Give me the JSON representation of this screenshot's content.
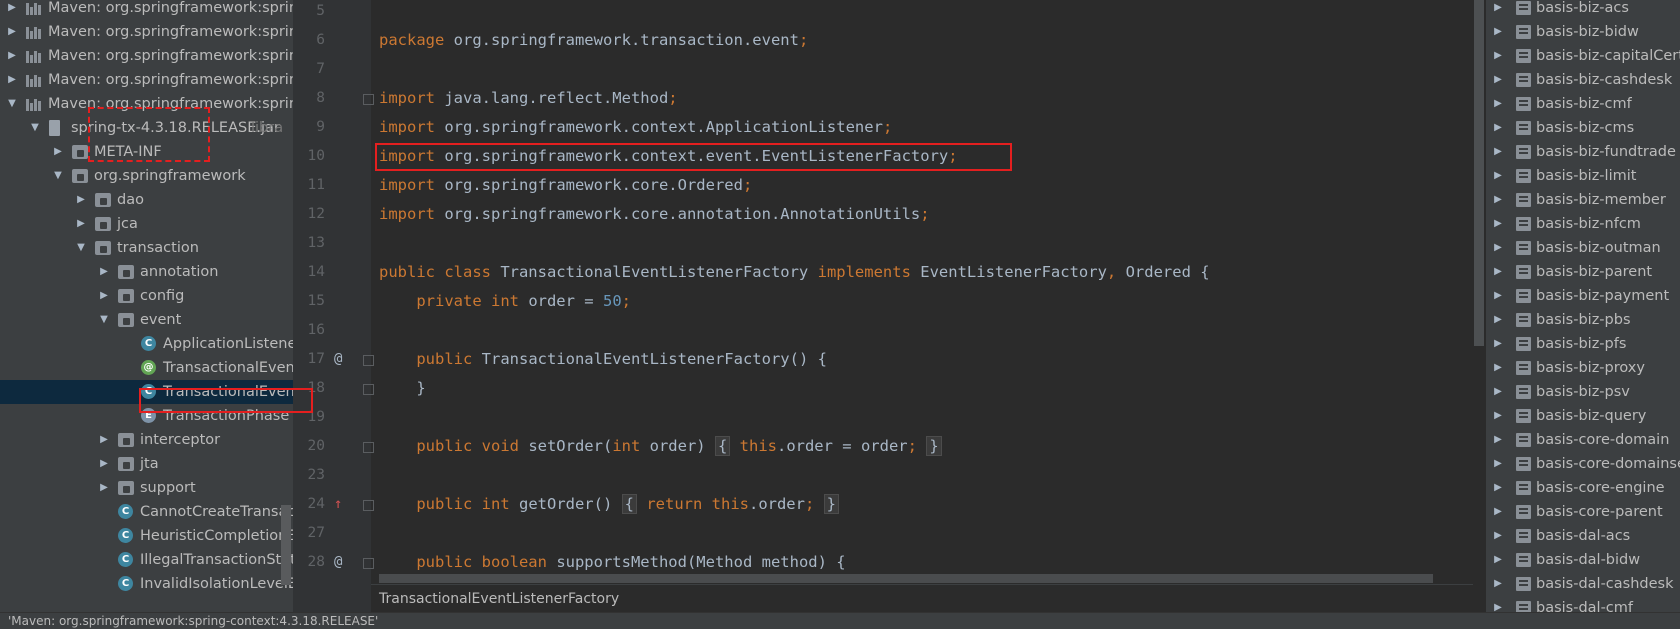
{
  "tree": [
    {
      "indent": 0,
      "arrow": "▶",
      "icon": "maven",
      "label": "Maven: org.springframework:spring-",
      "sel": false
    },
    {
      "indent": 0,
      "arrow": "▶",
      "icon": "maven",
      "label": "Maven: org.springframework:spring-",
      "sel": false
    },
    {
      "indent": 0,
      "arrow": "▶",
      "icon": "maven",
      "label": "Maven: org.springframework:spring-",
      "sel": false
    },
    {
      "indent": 0,
      "arrow": "▶",
      "icon": "maven",
      "label": "Maven: org.springframework:spring-",
      "sel": false
    },
    {
      "indent": 0,
      "arrow": "▼",
      "icon": "maven",
      "label": "Maven: org.springframework:spring-",
      "sel": false
    },
    {
      "indent": 1,
      "arrow": "▼",
      "icon": "jar",
      "label": "spring-tx-4.3.18.RELEASE.jar",
      "suffix": "libra",
      "sel": false
    },
    {
      "indent": 2,
      "arrow": "▶",
      "icon": "folder",
      "label": "META-INF",
      "sel": false
    },
    {
      "indent": 2,
      "arrow": "▼",
      "icon": "folder",
      "label": "org.springframework",
      "sel": false
    },
    {
      "indent": 3,
      "arrow": "▶",
      "icon": "folder",
      "label": "dao",
      "sel": false
    },
    {
      "indent": 3,
      "arrow": "▶",
      "icon": "folder",
      "label": "jca",
      "sel": false
    },
    {
      "indent": 3,
      "arrow": "▼",
      "icon": "folder",
      "label": "transaction",
      "sel": false
    },
    {
      "indent": 4,
      "arrow": "▶",
      "icon": "folder",
      "label": "annotation",
      "sel": false
    },
    {
      "indent": 4,
      "arrow": "▶",
      "icon": "folder",
      "label": "config",
      "sel": false
    },
    {
      "indent": 4,
      "arrow": "▼",
      "icon": "folder",
      "label": "event",
      "sel": false
    },
    {
      "indent": 5,
      "arrow": "",
      "icon": "class",
      "label": "ApplicationListene",
      "sel": false
    },
    {
      "indent": 5,
      "arrow": "",
      "icon": "anno",
      "label": "TransactionalEvent",
      "sel": false
    },
    {
      "indent": 5,
      "arrow": "",
      "icon": "class",
      "label": "TransactionalEvent",
      "sel": true
    },
    {
      "indent": 5,
      "arrow": "",
      "icon": "enum",
      "label": "TransactionPhase",
      "sel": false
    },
    {
      "indent": 4,
      "arrow": "▶",
      "icon": "folder",
      "label": "interceptor",
      "sel": false
    },
    {
      "indent": 4,
      "arrow": "▶",
      "icon": "folder",
      "label": "jta",
      "sel": false
    },
    {
      "indent": 4,
      "arrow": "▶",
      "icon": "folder",
      "label": "support",
      "sel": false
    },
    {
      "indent": 4,
      "arrow": "",
      "icon": "class",
      "label": "CannotCreateTransact",
      "sel": false
    },
    {
      "indent": 4,
      "arrow": "",
      "icon": "class",
      "label": "HeuristicCompletionEx",
      "sel": false
    },
    {
      "indent": 4,
      "arrow": "",
      "icon": "class",
      "label": "IllegalTransactionState",
      "sel": false
    },
    {
      "indent": 4,
      "arrow": "",
      "icon": "class",
      "label": "InvalidIsolationLevelEx",
      "sel": false
    }
  ],
  "code": [
    {
      "num": "5",
      "html": ""
    },
    {
      "num": "6",
      "html": "<span class='kw'>package</span> org.springframework.transaction.event<span class='sm'>;</span>"
    },
    {
      "num": "7",
      "html": ""
    },
    {
      "num": "8",
      "html": "<span class='kw'>import</span> java.lang.reflect.Method<span class='sm'>;</span>"
    },
    {
      "num": "9",
      "html": "<span class='kw'>import</span> org.springframework.context.ApplicationListener<span class='sm'>;</span>"
    },
    {
      "num": "10",
      "html": "<span class='kw'>import</span> org.springframework.context.event.EventListenerFactory<span class='sm'>;</span>"
    },
    {
      "num": "11",
      "html": "<span class='kw'>import</span> org.springframework.core.Ordered<span class='sm'>;</span>"
    },
    {
      "num": "12",
      "html": "<span class='kw'>import</span> org.springframework.core.annotation.AnnotationUtils<span class='sm'>;</span>"
    },
    {
      "num": "13",
      "html": ""
    },
    {
      "num": "14",
      "html": "<span class='kw'>public class</span> TransactionalEventListenerFactory <span class='kw'>implements</span> EventListenerFactory<span class='sm'>,</span> Ordered {"
    },
    {
      "num": "15",
      "html": "    <span class='kw'>private int</span> order = <span class='num'>50</span><span class='sm'>;</span>"
    },
    {
      "num": "16",
      "html": ""
    },
    {
      "num": "17",
      "html": "    <span class='kw'>public</span> TransactionalEventListenerFactory() {"
    },
    {
      "num": "18",
      "html": "    }"
    },
    {
      "num": "19",
      "html": ""
    },
    {
      "num": "20",
      "html": "    <span class='kw'>public void</span> setOrder(<span class='kw'>int</span> order) <span class='brk'>{</span> <span class='kw'>this</span>.order = order<span class='sm'>;</span> <span class='brk'>}</span>"
    },
    {
      "num": "23",
      "html": ""
    },
    {
      "num": "24",
      "html": "    <span class='kw'>public int</span> getOrder() <span class='brk'>{</span> <span class='kw'>return this</span>.order<span class='sm'>;</span> <span class='brk'>}</span>"
    },
    {
      "num": "27",
      "html": ""
    },
    {
      "num": "28",
      "html": "    <span class='kw'>public boolean</span> supportsMethod(Method method) {"
    }
  ],
  "gutter_marks": {
    "17": "@",
    "24": "!",
    "28": "@"
  },
  "breadcrumb": "TransactionalEventListenerFactory",
  "modules": [
    "basis-biz-acs",
    "basis-biz-bidw",
    "basis-biz-capitalCert",
    "basis-biz-cashdesk",
    "basis-biz-cmf",
    "basis-biz-cms",
    "basis-biz-fundtrade",
    "basis-biz-limit",
    "basis-biz-member",
    "basis-biz-nfcm",
    "basis-biz-outman",
    "basis-biz-parent",
    "basis-biz-payment",
    "basis-biz-pbs",
    "basis-biz-pfs",
    "basis-biz-proxy",
    "basis-biz-psv",
    "basis-biz-query",
    "basis-core-domain",
    "basis-core-domainser",
    "basis-core-engine",
    "basis-core-parent",
    "basis-dal-acs",
    "basis-dal-bidw",
    "basis-dal-cashdesk",
    "basis-dal-cmf"
  ],
  "status_text": "'Maven: org.springframework:spring-context:4.3.18.RELEASE'",
  "colors": {
    "highlight": "#e41f1f",
    "keyword": "#cc7832",
    "number": "#6897bb",
    "text": "#a9b7c6",
    "selection": "#0d293e"
  }
}
